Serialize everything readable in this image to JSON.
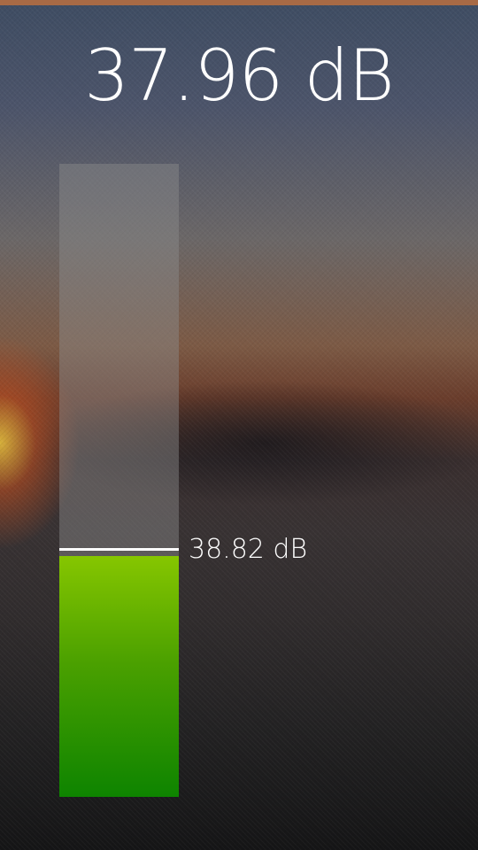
{
  "current_level": "37.96 dB",
  "peak": {
    "label": "38.82 dB"
  },
  "meter": {
    "fill_fraction": 0.38,
    "peak_fraction": 0.39,
    "fill_color_top": "#86c600",
    "fill_color_bottom": "#0e8400"
  }
}
